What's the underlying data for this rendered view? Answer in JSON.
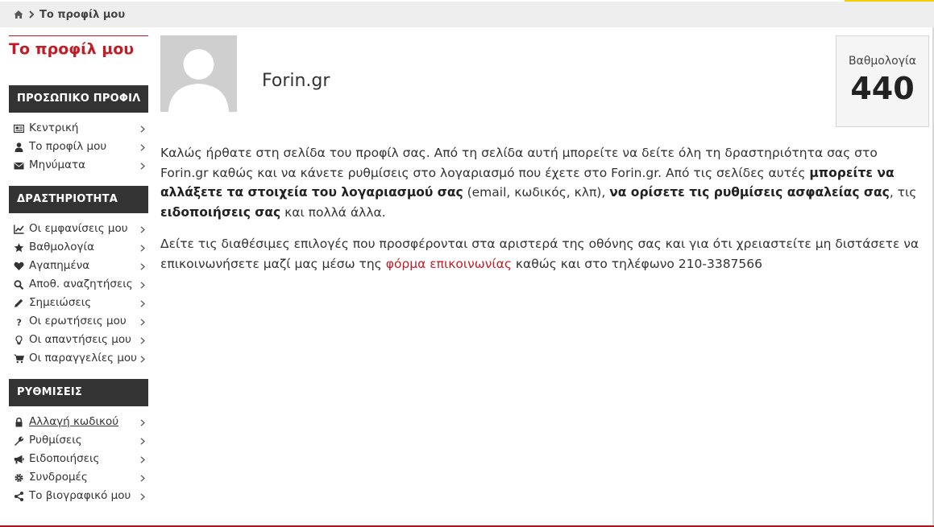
{
  "breadcrumb": {
    "current": "Το προφίλ μου"
  },
  "sidebar": {
    "title": "Το προφίλ μου",
    "sections": [
      {
        "heading": "ΠΡΟΣΩΠΙΚΟ ΠΡΟΦΙΛ",
        "items": [
          {
            "label": "Κεντρική",
            "icon": "newspaper-icon"
          },
          {
            "label": "Το προφίλ μου",
            "icon": "user-icon"
          },
          {
            "label": "Μηνύματα",
            "icon": "envelope-icon"
          }
        ]
      },
      {
        "heading": "ΔΡΑΣΤΗΡΙΟΤΗΤΑ",
        "items": [
          {
            "label": "Οι εμφανίσεις μου",
            "icon": "line-chart-icon"
          },
          {
            "label": "Βαθμολογία",
            "icon": "star-icon"
          },
          {
            "label": "Αγαπημένα",
            "icon": "heart-icon"
          },
          {
            "label": "Αποθ. αναζητήσεις",
            "icon": "search-icon"
          },
          {
            "label": "Σημειώσεις",
            "icon": "pencil-icon"
          },
          {
            "label": "Οι ερωτήσεις μου",
            "icon": "question-icon"
          },
          {
            "label": "Οι απαντήσεις μου",
            "icon": "lightbulb-icon"
          },
          {
            "label": "Οι παραγγελίες μου",
            "icon": "cart-icon"
          }
        ]
      },
      {
        "heading": "ΡΥΘΜΙΣΕΙΣ",
        "items": [
          {
            "label": "Αλλαγή κωδικού",
            "icon": "lock-icon"
          },
          {
            "label": "Ρυθμίσεις",
            "icon": "wrench-icon"
          },
          {
            "label": "Ειδοποιήσεις",
            "icon": "bullhorn-icon"
          },
          {
            "label": "Συνδρομές",
            "icon": "gear-icon"
          },
          {
            "label": "Το βιογραφικό μου",
            "icon": "share-icon"
          }
        ]
      }
    ]
  },
  "profile": {
    "username": "Forin.gr"
  },
  "score": {
    "label": "Βαθμολογία",
    "value": "440"
  },
  "content": {
    "p1_a": "Καλώς ήρθατε στη σελίδα του προφίλ σας. Από τη σελίδα αυτή μπορείτε να δείτε όλη τη δραστηριότητα σας στο Forin.gr καθώς και να κάνετε ρυθμίσεις στο λογαριασμό που έχετε στο Forin.gr. Από τις σελίδες αυτές ",
    "p1_b": "μπορείτε να αλλάξετε τα στοιχεία του λογαριασμού σας",
    "p1_c": " (email, κωδικός, κλπ), ",
    "p1_d": "να ορίσετε τις ρυθμίσεις ασφαλείας σας",
    "p1_e": ", τις ",
    "p1_f": "ειδοποιήσεις σας",
    "p1_g": " και πολλά άλλα.",
    "p2_a": "Δείτε τις διαθέσιμες επιλογές που προσφέρονται στα αριστερά της οθόνης σας και για ότι χρειαστείτε μη διστάσετε να επικοινωνήσετε μαζί μας μέσω της ",
    "p2_link": "φόρμα επικοινωνίας",
    "p2_b": " καθώς και στο τηλέφωνο 210-3387566"
  }
}
